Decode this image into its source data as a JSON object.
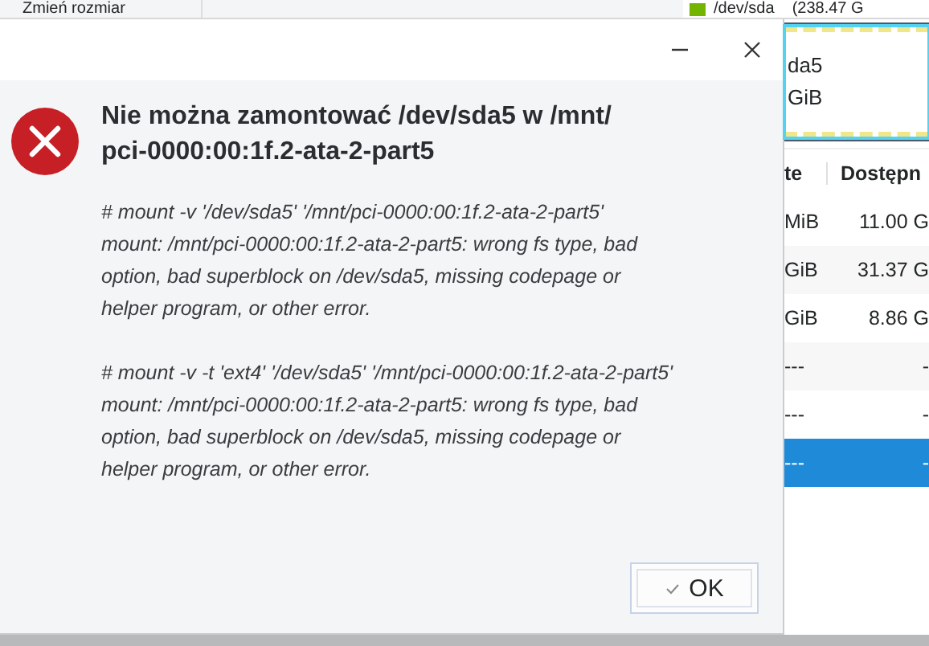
{
  "toolbar": {
    "buttons": [
      "Zmień rozmiar"
    ]
  },
  "disk": {
    "device": "/dev/sda",
    "size": "(238.47 G"
  },
  "partition_map": {
    "name": "da5",
    "size": "GiB"
  },
  "table": {
    "columns": [
      "te",
      "Dostępn"
    ],
    "rows": [
      {
        "cells": [
          "MiB",
          "11.00 G"
        ],
        "selected": false
      },
      {
        "cells": [
          "GiB",
          "31.37 G"
        ],
        "selected": false
      },
      {
        "cells": [
          "GiB",
          "8.86 G"
        ],
        "selected": false
      },
      {
        "cells": [
          "---",
          "-"
        ],
        "selected": false
      },
      {
        "cells": [
          "---",
          "-"
        ],
        "selected": false
      },
      {
        "cells": [
          "---",
          "-"
        ],
        "selected": true
      }
    ]
  },
  "dialog": {
    "kind": "error",
    "heading": "Nie można zamontować /dev/sda5 w /mnt/\npci-0000:00:1f.2-ata-2-part5",
    "messages": [
      "# mount -v '/dev/sda5' '/mnt/pci-0000:00:1f.2-ata-2-part5'\nmount: /mnt/pci-0000:00:1f.2-ata-2-part5: wrong fs type, bad\noption, bad superblock on /dev/sda5, missing codepage or\nhelper program, or other error.",
      "# mount -v -t 'ext4' '/dev/sda5' '/mnt/pci-0000:00:1f.2-ata-2-part5'\nmount: /mnt/pci-0000:00:1f.2-ata-2-part5: wrong fs type, bad\noption, bad superblock on /dev/sda5, missing codepage or\nhelper program, or other error."
    ],
    "buttons": [
      {
        "label": "OK"
      }
    ]
  }
}
